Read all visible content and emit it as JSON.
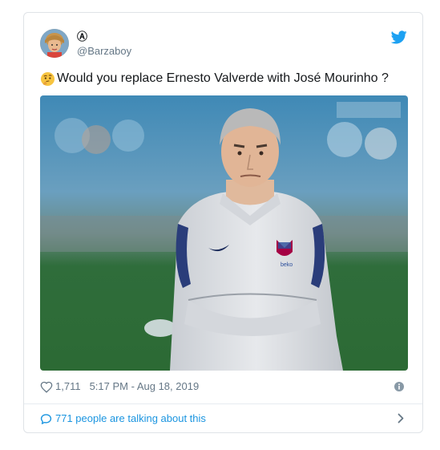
{
  "tweet": {
    "display_name_symbol": "Ⓐ",
    "handle": "@Barzaboy",
    "text": "Would you replace Ernesto Valverde with José Mourinho ?",
    "likes": "1,711",
    "timestamp": "5:17 PM - Aug 18, 2019",
    "conversation_label": "771 people are talking about this"
  },
  "icons": {
    "brand": "twitter-bird-icon",
    "emoji": "thinking-face-icon",
    "like": "heart-icon",
    "info": "info-icon",
    "conversation": "speech-bubble-icon",
    "more": "chevron-right-icon"
  },
  "colors": {
    "twitter_blue": "#1da1f2",
    "link_blue": "#1b95e0",
    "secondary_text": "#657786",
    "border": "#dfe3e7"
  }
}
